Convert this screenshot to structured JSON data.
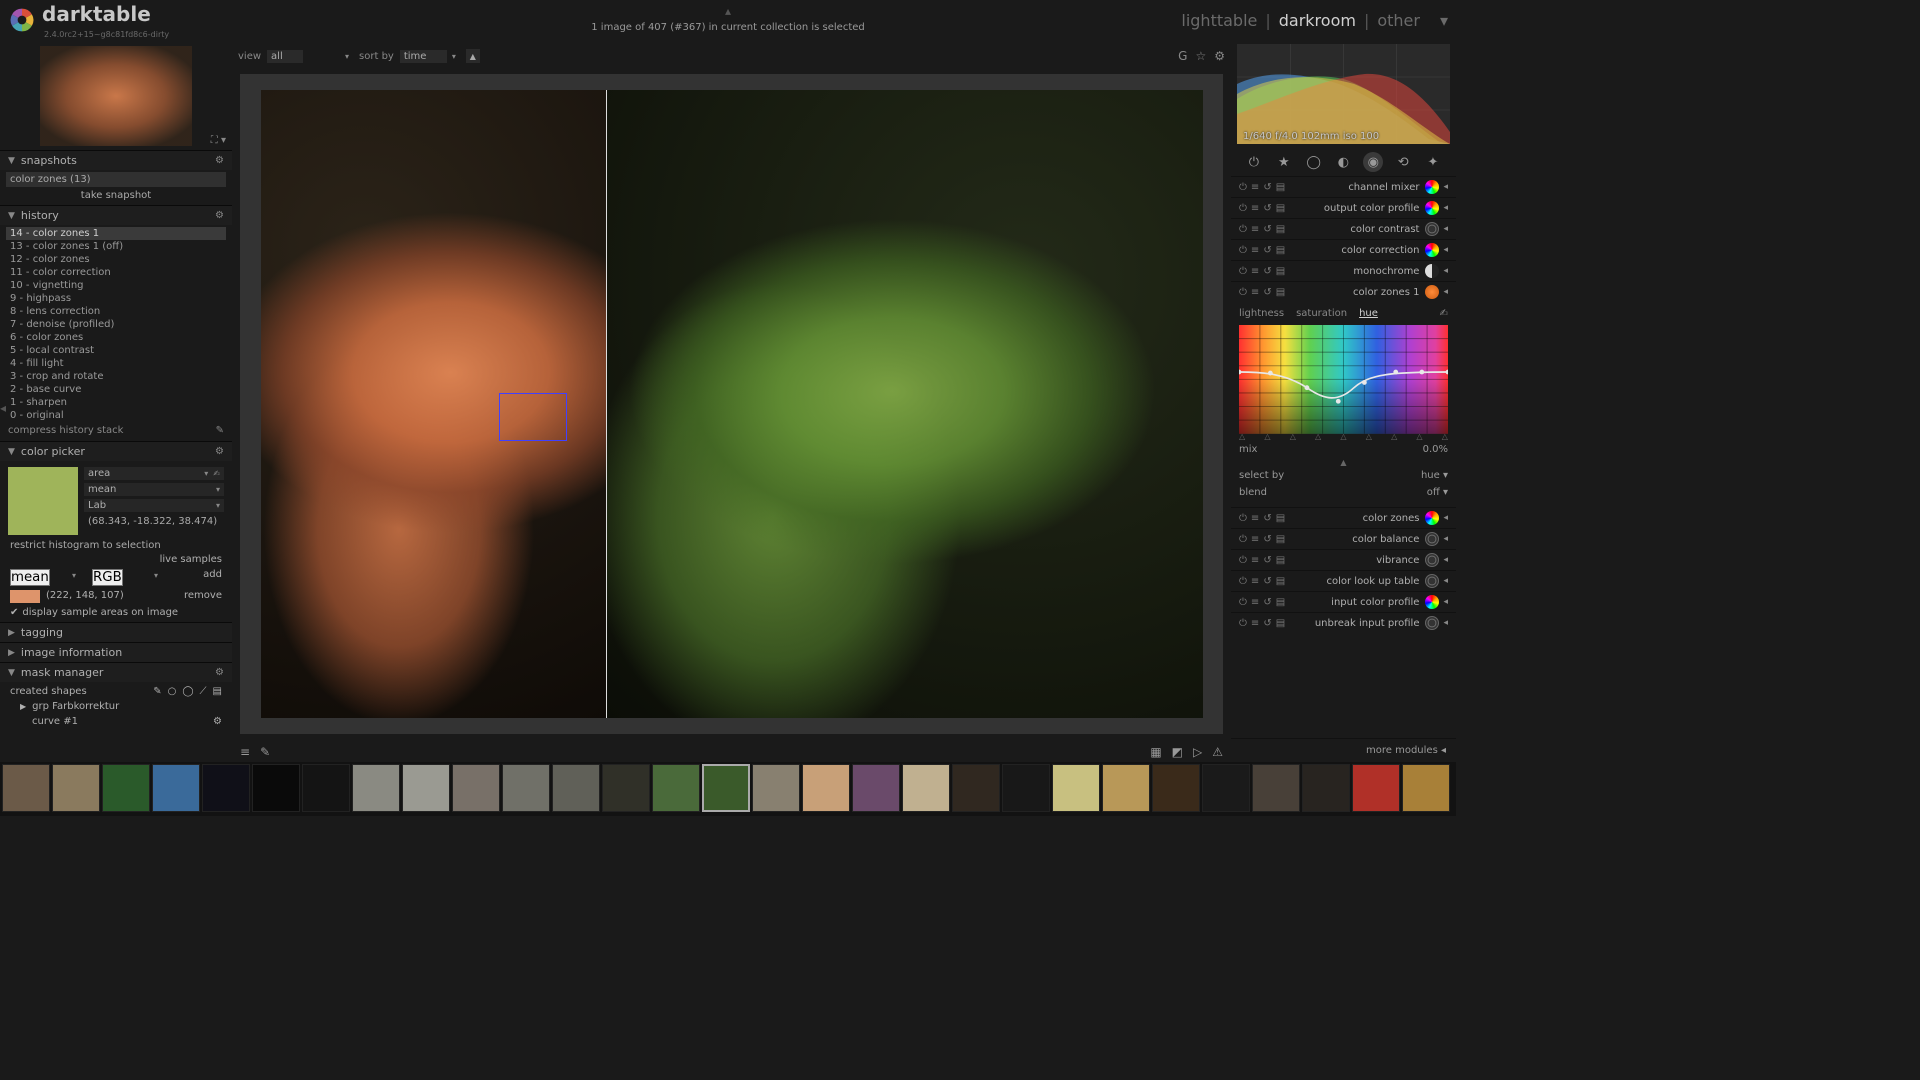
{
  "app": {
    "name": "darktable",
    "version": "2.4.0rc2+15~g8c81fd8c6-dirty"
  },
  "status": "1 image of 407 (#367) in current collection is selected",
  "modes": {
    "lighttable": "lighttable",
    "darkroom": "darkroom",
    "other": "other",
    "active": "darkroom"
  },
  "center_toolbar": {
    "view_label": "view",
    "view_value": "all",
    "sort_label": "sort by",
    "sort_value": "time"
  },
  "snapshots": {
    "title": "snapshots",
    "item": "color zones (13)",
    "action": "take snapshot"
  },
  "history": {
    "title": "history",
    "items": [
      "14 - color zones 1",
      "13 - color zones 1 (off)",
      "12 - color zones",
      "11 - color correction",
      "10 - vignetting",
      "9 - highpass",
      "8 - lens correction",
      "7 - denoise (profiled)",
      "6 - color zones",
      "5 - local contrast",
      "4 - fill light",
      "3 - crop and rotate",
      "2 - base curve",
      "1 - sharpen",
      "0 - original"
    ],
    "selected": 0,
    "compress": "compress history stack"
  },
  "color_picker": {
    "title": "color picker",
    "mode": "area",
    "stat": "mean",
    "space": "Lab",
    "lab": "(68.343, -18.322, 38.474)",
    "restrict": "restrict histogram to selection",
    "live": "live samples",
    "stat2": "mean",
    "space2": "RGB",
    "add": "add",
    "rgb": "(222, 148, 107)",
    "remove": "remove",
    "display_chk": "display sample areas on image"
  },
  "tagging": {
    "title": "tagging"
  },
  "image_info": {
    "title": "image information"
  },
  "mask_manager": {
    "title": "mask manager",
    "created": "created shapes",
    "grp": "grp Farbkorrektur",
    "curve": "curve #1"
  },
  "exif": "1/640 f/4.0 102mm iso 100",
  "modules": [
    {
      "name": "channel mixer",
      "ico": "rainbow"
    },
    {
      "name": "output color profile",
      "ico": "rainbow"
    },
    {
      "name": "color contrast",
      "ico": "ring"
    },
    {
      "name": "color correction",
      "ico": "rainbow"
    },
    {
      "name": "monochrome",
      "ico": "half"
    },
    {
      "name": "color zones 1",
      "ico": "orange",
      "expanded": true
    }
  ],
  "color_zones": {
    "tabs": {
      "l": "lightness",
      "s": "saturation",
      "h": "hue"
    },
    "mix_label": "mix",
    "mix_value": "0.0%",
    "select_label": "select by",
    "select_value": "hue",
    "blend_label": "blend",
    "blend_value": "off"
  },
  "modules2": [
    {
      "name": "color zones",
      "ico": "rainbow"
    },
    {
      "name": "color balance",
      "ico": "ring"
    },
    {
      "name": "vibrance",
      "ico": "ring"
    },
    {
      "name": "color look up table",
      "ico": "ring"
    },
    {
      "name": "input color profile",
      "ico": "rainbow"
    },
    {
      "name": "unbreak input profile",
      "ico": "ring"
    }
  ],
  "more_modules": "more modules",
  "filmstrip_count": 29,
  "filmstrip_selected": 14
}
